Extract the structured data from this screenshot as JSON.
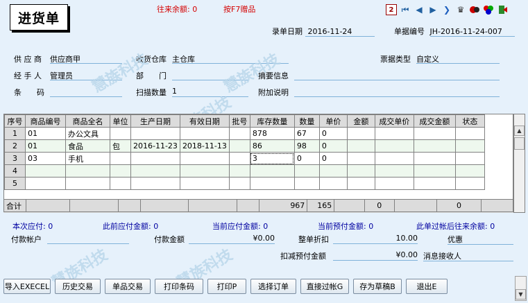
{
  "header": {
    "title": "进货单",
    "balance_label": "往来余额:",
    "balance_value": "0",
    "f7_hint": "按F7赠品",
    "date_label": "录单日期",
    "date_value": "2016-11-24",
    "docno_label": "单据编号",
    "docno_value": "JH-2016-11-24-007"
  },
  "toolbar": {
    "icons": [
      "print-icon",
      "first-record-icon",
      "prev-record-icon",
      "next-record-icon",
      "last-record-icon",
      "jump-icon",
      "stamp-icon",
      "user-icon",
      "color-icon",
      "exit-icon"
    ]
  },
  "form": {
    "supplier_label": "供 应 商",
    "supplier_value": "供应商甲",
    "warehouse_label": "收货仓库",
    "warehouse_value": "主仓库",
    "doctype_label": "票据类型",
    "doctype_value": "自定义",
    "handler_label": "经 手 人",
    "handler_value": "管理员",
    "dept_label": "部　　门",
    "dept_value": "",
    "summary_label": "摘要信息",
    "summary_value": "",
    "barcode_label": "条　　码",
    "barcode_value": "",
    "scan_label": "扫描数量",
    "scan_value": "1",
    "extra_label": "附加说明",
    "extra_value": ""
  },
  "grid": {
    "columns": [
      "序号",
      "商品编号",
      "商品全名",
      "单位",
      "生产日期",
      "有效日期",
      "批号",
      "库存数量",
      "数量",
      "单价",
      "金额",
      "成交单价",
      "成交金额",
      "状态"
    ],
    "rows": [
      [
        "1",
        "01",
        "办公文具",
        "",
        "",
        "",
        "",
        "878",
        "67",
        "0",
        "",
        "",
        "",
        ""
      ],
      [
        "2",
        "01",
        "食品",
        "包",
        "2016-11-23",
        "2018-11-13",
        "",
        "86",
        "98",
        "0",
        "",
        "",
        "",
        ""
      ],
      [
        "3",
        "03",
        "手机",
        "",
        "",
        "",
        "",
        "3",
        "0",
        "0",
        "",
        "",
        "",
        ""
      ],
      [
        "4",
        "",
        "",
        "",
        "",
        "",
        "",
        "",
        "",
        "",
        "",
        "",
        "",
        ""
      ],
      [
        "5",
        "",
        "",
        "",
        "",
        "",
        "",
        "",
        "",
        "",
        "",
        "",
        "",
        ""
      ]
    ],
    "total_label": "合计",
    "total_stock": "967",
    "total_qty": "165",
    "total_amount": "0",
    "total_deal_amount": "0"
  },
  "summary": {
    "payable_label": "本次应付:",
    "payable_value": "0",
    "prev_payable_label": "此前应付金额:",
    "prev_payable_value": "0",
    "cur_payable_label": "当前应付金额:",
    "cur_payable_value": "0",
    "prepaid_label": "当前预付金额:",
    "prepaid_value": "0",
    "after_balance_label": "此单过帐后往来余额:",
    "after_balance_value": "0",
    "pay_account_label": "付款帐户",
    "pay_account_value": "",
    "pay_amount_label": "付款金额",
    "pay_amount_value": "¥0.00",
    "discount_label": "整单折扣",
    "discount_value": "10.00",
    "promo_label": "优惠",
    "promo_value": "",
    "deduct_label": "扣减预付金额",
    "deduct_value": "¥0.00",
    "receiver_label": "消息接收人",
    "receiver_value": ""
  },
  "buttons": [
    "导入EXECEL",
    "历史交易",
    "单品交易",
    "打印条码",
    "打印P",
    "选择订单",
    "直接过帐G",
    "存为草稿B",
    "退出E"
  ],
  "watermark": "慧族科技"
}
